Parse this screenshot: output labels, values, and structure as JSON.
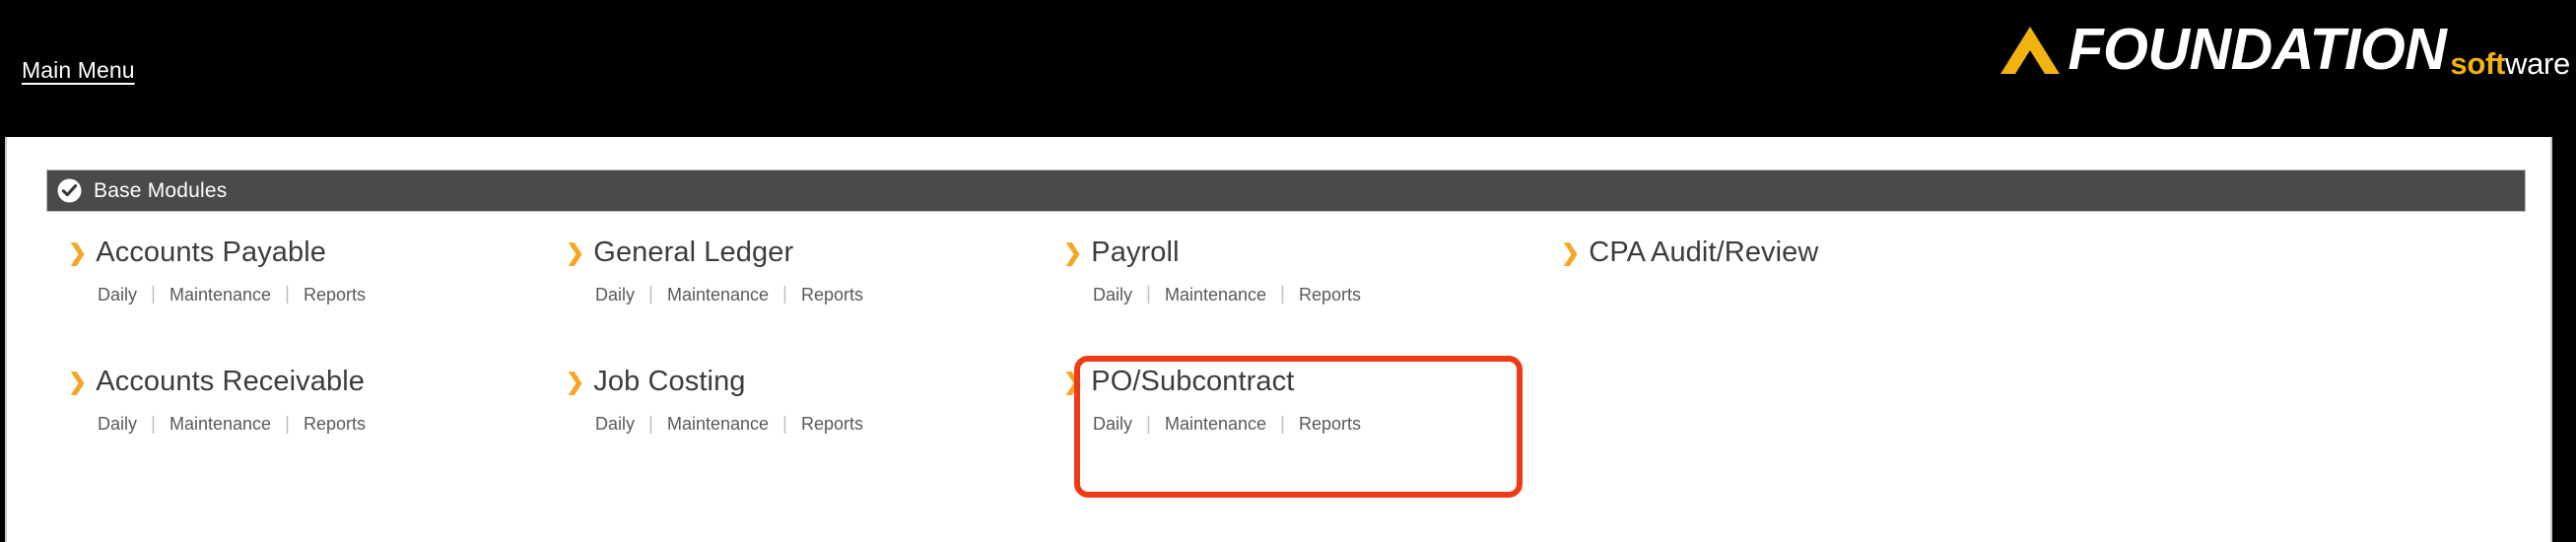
{
  "header": {
    "main_menu_label": "Main Menu",
    "logo": {
      "chevron_icon": "chevron-up-icon",
      "brand": "FOUNDATION",
      "suffix_bold": "soft",
      "suffix_light": "ware",
      "brand_color": "#ffffff",
      "accent_color": "#f0b310",
      "background": "#000000"
    }
  },
  "section": {
    "icon": "check-circle-icon",
    "title": "Base Modules",
    "bar_color": "#4a4a4a"
  },
  "colors": {
    "chevron": "#f5a623",
    "module_title": "#3c3c3c",
    "sublink": "#595959",
    "highlight": "#ec3b16",
    "page_background": "#ffffff"
  },
  "modules": [
    {
      "name": "Accounts Payable",
      "chevron_icon": "chevron-right-icon",
      "sublinks": [
        "Daily",
        "Maintenance",
        "Reports"
      ],
      "highlighted": false
    },
    {
      "name": "General Ledger",
      "chevron_icon": "chevron-right-icon",
      "sublinks": [
        "Daily",
        "Maintenance",
        "Reports"
      ],
      "highlighted": false
    },
    {
      "name": "Payroll",
      "chevron_icon": "chevron-right-icon",
      "sublinks": [
        "Daily",
        "Maintenance",
        "Reports"
      ],
      "highlighted": false
    },
    {
      "name": "CPA Audit/Review",
      "chevron_icon": "chevron-right-icon",
      "sublinks": [],
      "highlighted": false
    },
    {
      "name": "Accounts Receivable",
      "chevron_icon": "chevron-right-icon",
      "sublinks": [
        "Daily",
        "Maintenance",
        "Reports"
      ],
      "highlighted": false
    },
    {
      "name": "Job Costing",
      "chevron_icon": "chevron-right-icon",
      "sublinks": [
        "Daily",
        "Maintenance",
        "Reports"
      ],
      "highlighted": false
    },
    {
      "name": "PO/Subcontract",
      "chevron_icon": "chevron-right-icon",
      "sublinks": [
        "Daily",
        "Maintenance",
        "Reports"
      ],
      "highlighted": true
    }
  ],
  "separator": "|"
}
